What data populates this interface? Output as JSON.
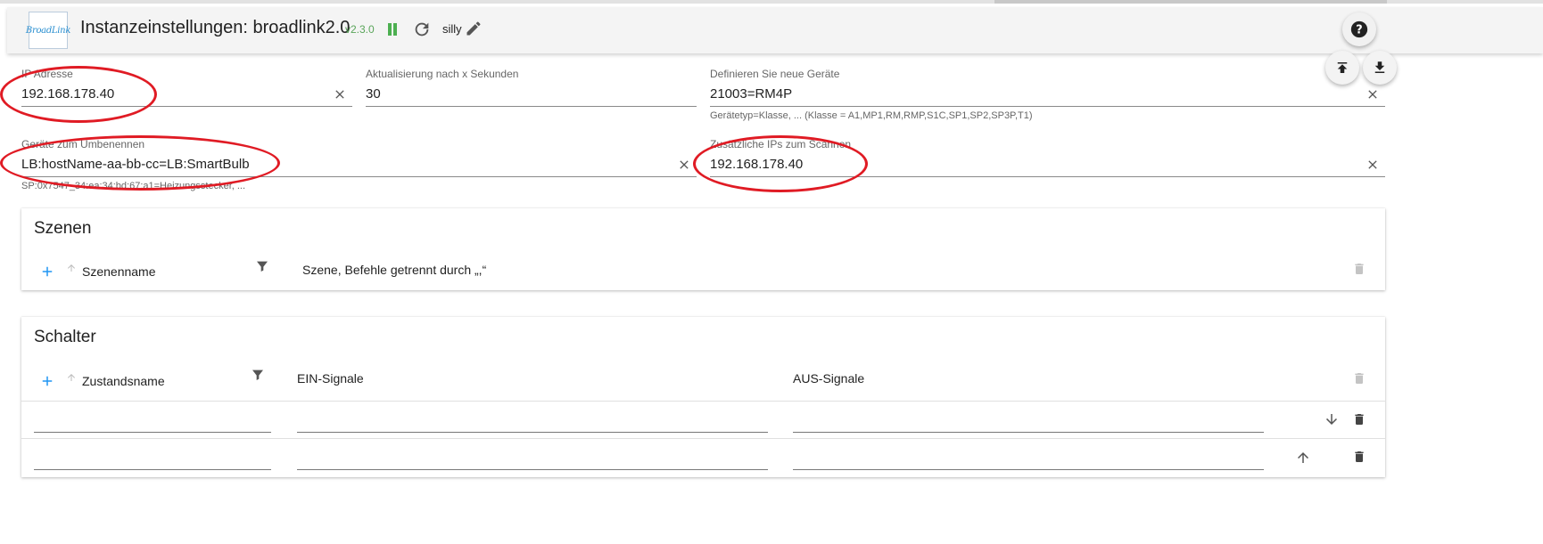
{
  "header": {
    "logo_text": "BroadLink",
    "title": "Instanzeinstellungen: broadlink2.0",
    "version": "v2.3.0",
    "log_level": "silly",
    "icons": [
      "pause-icon",
      "refresh-icon",
      "pencil-icon",
      "help-icon",
      "upload-icon",
      "download-icon"
    ]
  },
  "fields": {
    "ip": {
      "label": "IP Adresse",
      "value": "192.168.178.40"
    },
    "refresh": {
      "label": "Aktualisierung nach x Sekunden",
      "value": "30"
    },
    "new_devices": {
      "label": "Definieren Sie neue Geräte",
      "value": "21003=RM4P",
      "helper": "Gerätetyp=Klasse, ... (Klasse = A1,MP1,RM,RMP,S1C,SP1,SP2,SP3P,T1)"
    },
    "rename": {
      "label": "Geräte zum Umbenennen",
      "value": "LB:hostName-aa-bb-cc=LB:SmartBulb",
      "helper": "SP:0x7547_34:ea:34:bd:67:a1=Heizungsstecker, ..."
    },
    "scan_ips": {
      "label": "Zusätzliche IPs zum Scannen",
      "value": "192.168.178.40"
    }
  },
  "scenes": {
    "title": "Szenen",
    "columns": [
      "Szenenname",
      "Szene, Befehle getrennt durch „,“"
    ]
  },
  "switches": {
    "title": "Schalter",
    "columns": [
      "Zustandsname",
      "EIN-Signale",
      "AUS-Signale"
    ],
    "rows": [
      {
        "name": "",
        "on": "",
        "off": ""
      },
      {
        "name": "",
        "on": "",
        "off": ""
      }
    ]
  },
  "colors": {
    "accent": "#2196f3",
    "version_green": "#5aa55a",
    "annotation_red": "#e01b24"
  }
}
